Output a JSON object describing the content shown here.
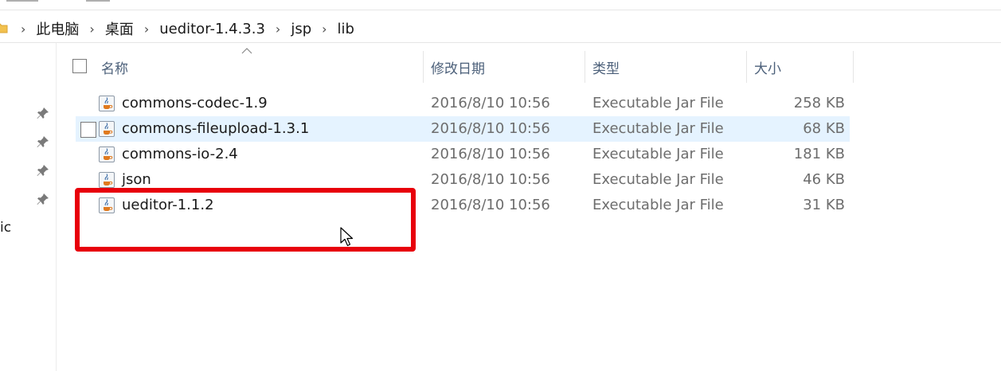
{
  "address_bar": {
    "crumbs": [
      "此电脑",
      "桌面",
      "ueditor-1.4.3.3",
      "jsp",
      "lib"
    ],
    "separator": "›"
  },
  "nav_pane": {
    "partial_label": "ic"
  },
  "columns": {
    "name": "名称",
    "date_modified": "修改日期",
    "type": "类型",
    "size": "大小"
  },
  "files": [
    {
      "name": "commons-codec-1.9",
      "date": "2016/8/10 10:56",
      "type": "Executable Jar File",
      "size": "258 KB"
    },
    {
      "name": "commons-fileupload-1.3.1",
      "date": "2016/8/10 10:56",
      "type": "Executable Jar File",
      "size": "68 KB"
    },
    {
      "name": "commons-io-2.4",
      "date": "2016/8/10 10:56",
      "type": "Executable Jar File",
      "size": "181 KB"
    },
    {
      "name": "json",
      "date": "2016/8/10 10:56",
      "type": "Executable Jar File",
      "size": "46 KB"
    },
    {
      "name": "ueditor-1.1.2",
      "date": "2016/8/10 10:56",
      "type": "Executable Jar File",
      "size": "31 KB"
    }
  ],
  "colors": {
    "accent_highlight": "#e5f3ff",
    "annotation_red": "#e8000b",
    "header_text": "#4c607a"
  },
  "icons": {
    "file": "java-jar-icon",
    "pin": "pin-icon",
    "folder": "folder-icon"
  }
}
